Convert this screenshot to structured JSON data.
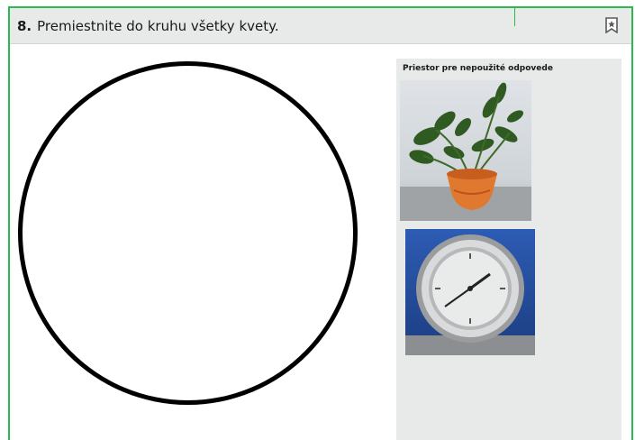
{
  "question": {
    "number": "8.",
    "text": "Premiestnite do kruhu všetky kvety."
  },
  "header": {
    "bookmark_icon": "bookmark-icon"
  },
  "answer_bank": {
    "label": "Priestor pre nepoužité odpovede",
    "items": [
      {
        "icon": "potted-plant-image"
      },
      {
        "icon": "wall-clock-image"
      }
    ]
  },
  "colors": {
    "frame_accent": "#2db84d",
    "header_bg": "#e8eaea",
    "bank_bg": "#e8e9e9",
    "circle_stroke": "#000000"
  }
}
